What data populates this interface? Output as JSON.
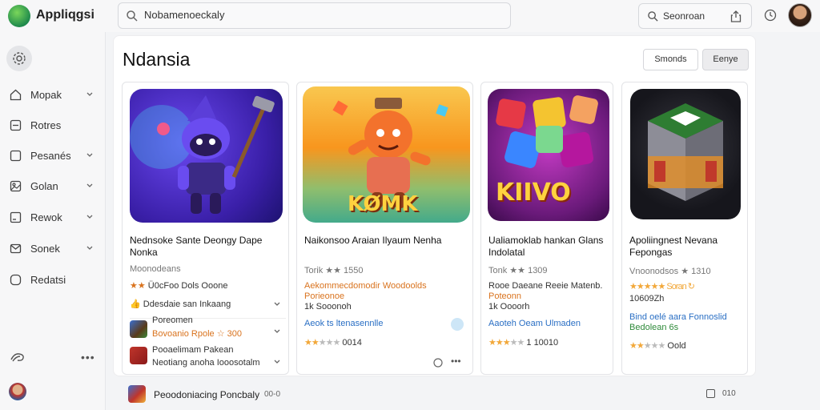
{
  "app": {
    "name": "Appliqgsi"
  },
  "search": {
    "value": "Nobamenoeckaly"
  },
  "topbar": {
    "search_button_label": "Seonroan"
  },
  "sidebar": {
    "items": [
      {
        "label": "Mopak",
        "icon": "home-icon",
        "has_chevron": true
      },
      {
        "label": "Rotres",
        "icon": "inbox-icon",
        "has_chevron": false
      },
      {
        "label": "Pesanés",
        "icon": "document-icon",
        "has_chevron": true
      },
      {
        "label": "Golan",
        "icon": "gallery-icon",
        "has_chevron": true
      },
      {
        "label": "Rewok",
        "icon": "list-icon",
        "has_chevron": true
      },
      {
        "label": "Sonek",
        "icon": "mail-icon",
        "has_chevron": true
      },
      {
        "label": "Redatsi",
        "icon": "chat-icon",
        "has_chevron": false
      }
    ]
  },
  "page": {
    "title": "Ndansia",
    "secondary_button": "Smonds",
    "primary_button": "Eenye"
  },
  "cards": [
    {
      "title": "Nednsoke Sante Deongy Dape Nonka",
      "meta": "Moonodeans",
      "artwork_colors": [
        "#4a2fcf",
        "#8a4fe8",
        "#3ab0e6"
      ],
      "rows": [
        {
          "text": "Ü0cFoo Dols Ooone",
          "prefix": "★★"
        },
        {
          "text": "Ddesdaie san Inkaang",
          "prefix": "thumbs-up-icon"
        },
        {
          "text": "Poreomen",
          "prefix": "game-icon"
        },
        {
          "text": "Bovoanio Rpole ☆ 300",
          "prefix": ""
        },
        {
          "text": "Pooaelimam Pakean",
          "prefix": "game-icon-2"
        },
        {
          "text": "Neotiang anoha Iooosotalm",
          "prefix": ""
        }
      ]
    },
    {
      "title": "Naikonsoo Araian Ilyaum Nenha",
      "meta": "Torik ★★ 1550",
      "artwork_colors": [
        "#f7b733",
        "#fc4a1a",
        "#3fa34d"
      ],
      "artwork_text": "KØMK",
      "rows": [
        {
          "text": "Aekommecdomodir Woodoolds",
          "prefix": ""
        },
        {
          "text": "Porieonoe",
          "prefix": ""
        },
        {
          "text": "1k Sooonoh",
          "prefix": ""
        },
        {
          "text": "Aeok ts ltenasennlle",
          "prefix": ""
        }
      ],
      "rating_text": "0014",
      "stars_on": 2
    },
    {
      "title": "Ualiamoklab hankan Glans Indolatal",
      "meta": "Tonk ★★ 1309",
      "artwork_colors": [
        "#7a1e8a",
        "#c23ac2",
        "#f2c33a"
      ],
      "artwork_text": "KIIVO",
      "rows": [
        {
          "text": "Rooe Daeane Reeie Matenb.",
          "prefix": ""
        },
        {
          "text": "Poteonn",
          "prefix": ""
        },
        {
          "text": "1k Oooorh",
          "prefix": ""
        },
        {
          "text": "Aaoteh Oeam Ulmaden",
          "prefix": ""
        }
      ],
      "rating_text": "1 10010",
      "stars_on": 3
    },
    {
      "title": "Apoliingnest Nevana Fepongas",
      "meta": "Vnoonodsos ★ 1310",
      "artwork_colors": [
        "#2b2b2b",
        "#c0392b",
        "#e67e22"
      ],
      "rows": [
        {
          "text": "★★★★★ Soran ↻",
          "prefix": ""
        },
        {
          "text": "10609Zh",
          "prefix": ""
        },
        {
          "text": "Bind oelé aara Fonnoslid",
          "prefix": ""
        },
        {
          "text": "Bedolean 6s",
          "prefix": ""
        }
      ],
      "rating_text": "Oold",
      "stars_on": 2
    }
  ],
  "bottom": {
    "label": "Peoodoniacing Poncbaly",
    "extra": "00-0",
    "count": "010"
  }
}
